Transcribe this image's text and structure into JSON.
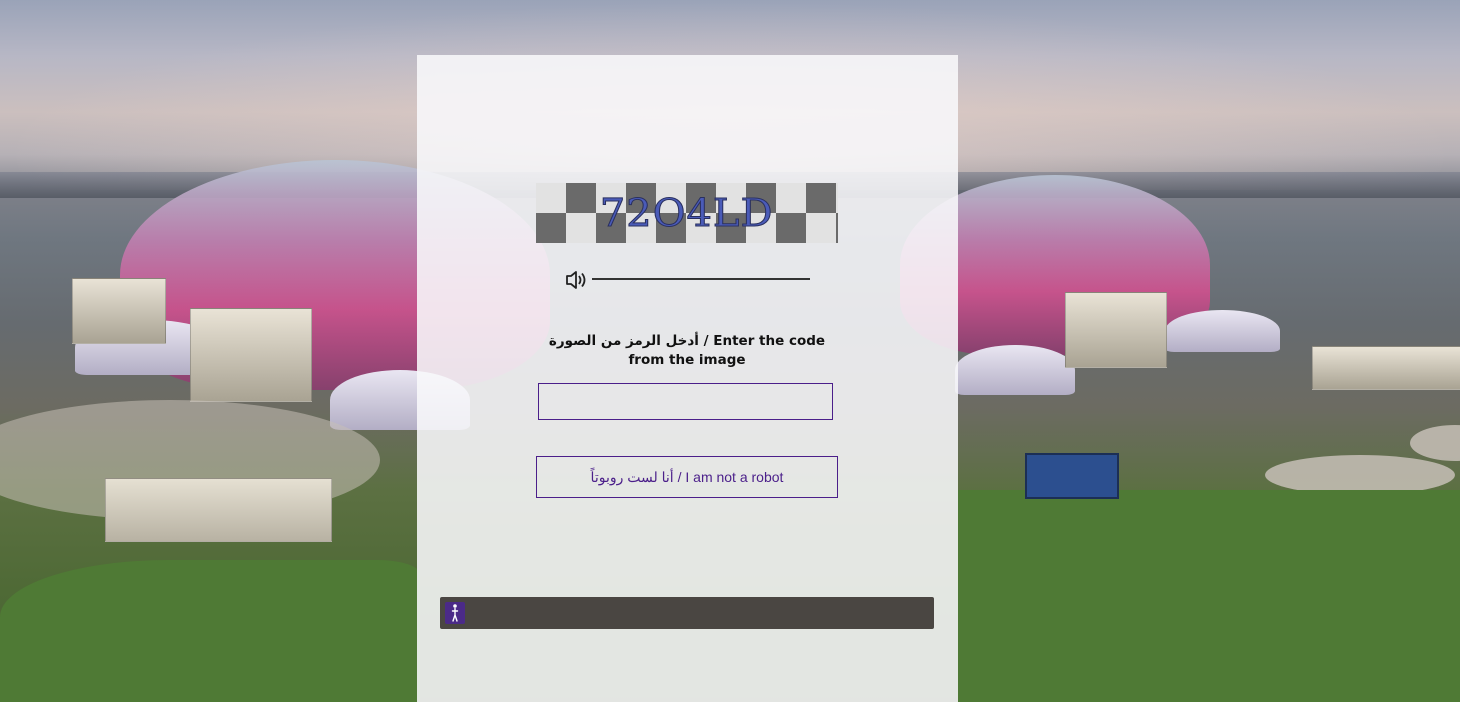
{
  "captcha": {
    "image_text": "72O4LD",
    "audio_icon": "speaker-icon",
    "prompt_label": "أدخل الرمز من الصورة / Enter the code from the image"
  },
  "form": {
    "code_input_value": "",
    "code_input_placeholder": "",
    "robot_button_label": "أنا لست روبوتاً / I am not a robot"
  },
  "accessibility": {
    "icon": "accessibility-person-icon"
  },
  "colors": {
    "accent": "#4b1f8a",
    "panel": "#f8f8fa",
    "accessibility_bar": "#4a4642"
  }
}
